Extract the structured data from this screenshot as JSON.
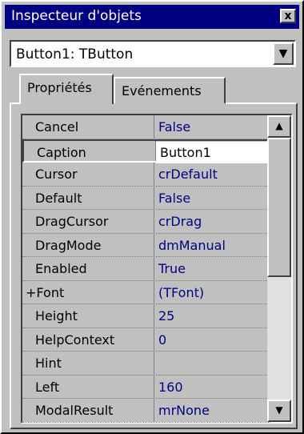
{
  "window": {
    "title": "Inspecteur d'objets",
    "close_label": "x"
  },
  "combo": {
    "value": "Button1: TButton",
    "arrow": "▼"
  },
  "tabs": [
    {
      "label": "Propriétés",
      "active": true
    },
    {
      "label": "Evénements",
      "active": false
    }
  ],
  "properties": [
    {
      "name": "Cancel",
      "value": "False"
    },
    {
      "name": "Caption",
      "value": "Button1",
      "selected": true
    },
    {
      "name": "Cursor",
      "value": "crDefault"
    },
    {
      "name": "Default",
      "value": "False"
    },
    {
      "name": "DragCursor",
      "value": "crDrag"
    },
    {
      "name": "DragMode",
      "value": "dmManual"
    },
    {
      "name": "Enabled",
      "value": "True"
    },
    {
      "name": "+Font",
      "value": "(TFont)"
    },
    {
      "name": "Height",
      "value": "25"
    },
    {
      "name": "HelpContext",
      "value": "0"
    },
    {
      "name": "Hint",
      "value": ""
    },
    {
      "name": "Left",
      "value": "160"
    },
    {
      "name": "ModalResult",
      "value": "mrNone"
    }
  ],
  "scrollbar": {
    "up_arrow": "▲",
    "down_arrow": "▼",
    "position": 0
  },
  "colors": {
    "titlebar": "#000080",
    "face": "#c0c0c0",
    "value_text": "#000080"
  }
}
